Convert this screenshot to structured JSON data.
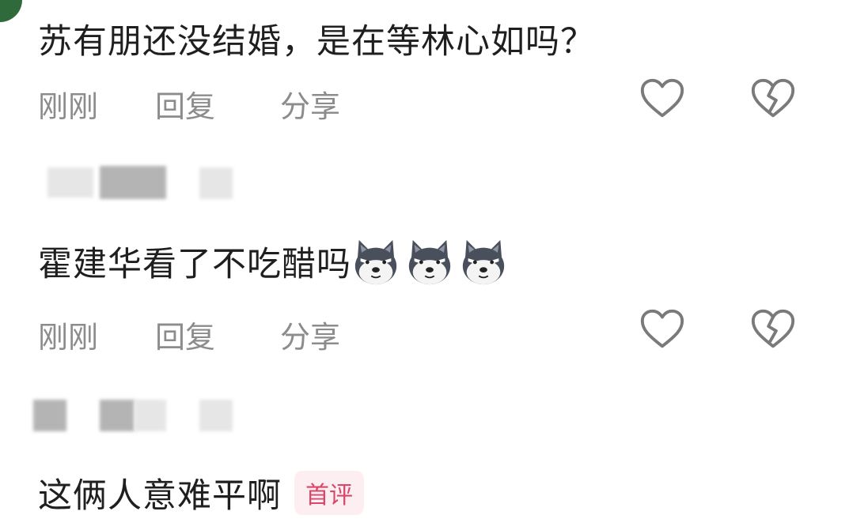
{
  "comments": [
    {
      "text": "苏有朋还没结婚，是在等林心如吗？",
      "time": "刚刚",
      "reply_label": "回复",
      "share_label": "分享"
    },
    {
      "text": "霍建华看了不吃醋吗",
      "emoji": [
        "doge-emoji",
        "doge-emoji",
        "doge-emoji"
      ],
      "time": "刚刚",
      "reply_label": "回复",
      "share_label": "分享"
    },
    {
      "text": "这俩人意难平啊",
      "badge": "首评"
    }
  ],
  "icons": {
    "like": "heart-outline-icon",
    "dislike": "broken-heart-icon"
  },
  "colors": {
    "text": "#1f1f1f",
    "muted": "#8c8c8c",
    "badge_text": "#d8476a",
    "badge_bg": "#fdeef2",
    "avatar": "#2f6b3a"
  }
}
